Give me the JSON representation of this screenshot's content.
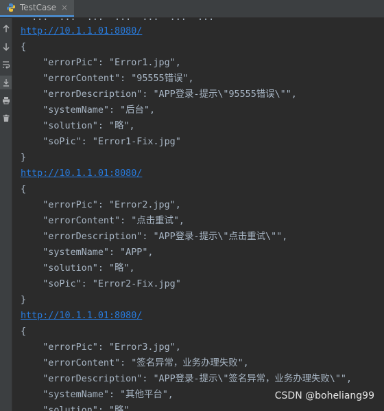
{
  "tab": {
    "title": "TestCase",
    "close_glyph": "×",
    "icon": "python-icon"
  },
  "toolbar": [
    {
      "icon": "up-arrow-icon"
    },
    {
      "icon": "down-arrow-icon"
    },
    {
      "icon": "soft-wrap-icon"
    },
    {
      "icon": "scroll-to-end-icon"
    },
    {
      "icon": "print-icon"
    },
    {
      "icon": "trash-icon"
    }
  ],
  "console": {
    "clipped_line": "  ...  ...  ...  ...  ...  ...  ...",
    "lines": [
      {
        "kind": "link",
        "text": "http://10.1.1.01:8080/"
      },
      {
        "kind": "text",
        "text": "{"
      },
      {
        "kind": "text",
        "text": "    \"errorPic\": \"Error1.jpg\","
      },
      {
        "kind": "text",
        "text": "    \"errorContent\": \"95555错误\","
      },
      {
        "kind": "text",
        "text": "    \"errorDescription\": \"APP登录-提示\\\"95555错误\\\"\","
      },
      {
        "kind": "text",
        "text": "    \"systemName\": \"后台\","
      },
      {
        "kind": "text",
        "text": "    \"solution\": \"略\","
      },
      {
        "kind": "text",
        "text": "    \"soPic\": \"Error1-Fix.jpg\""
      },
      {
        "kind": "text",
        "text": "}"
      },
      {
        "kind": "link",
        "text": "http://10.1.1.01:8080/"
      },
      {
        "kind": "text",
        "text": "{"
      },
      {
        "kind": "text",
        "text": "    \"errorPic\": \"Error2.jpg\","
      },
      {
        "kind": "text",
        "text": "    \"errorContent\": \"点击重试\","
      },
      {
        "kind": "text",
        "text": "    \"errorDescription\": \"APP登录-提示\\\"点击重试\\\"\","
      },
      {
        "kind": "text",
        "text": "    \"systemName\": \"APP\","
      },
      {
        "kind": "text",
        "text": "    \"solution\": \"略\","
      },
      {
        "kind": "text",
        "text": "    \"soPic\": \"Error2-Fix.jpg\""
      },
      {
        "kind": "text",
        "text": "}"
      },
      {
        "kind": "link",
        "text": "http://10.1.1.01:8080/"
      },
      {
        "kind": "text",
        "text": "{"
      },
      {
        "kind": "text",
        "text": "    \"errorPic\": \"Error3.jpg\","
      },
      {
        "kind": "text",
        "text": "    \"errorContent\": \"签名异常，业务办理失败\","
      },
      {
        "kind": "text",
        "text": "    \"errorDescription\": \"APP登录-提示\\\"签名异常，业务办理失败\\\"\","
      },
      {
        "kind": "text",
        "text": "    \"systemName\": \"其他平台\","
      },
      {
        "kind": "text",
        "text": "    \"solution\": \"略\""
      }
    ]
  },
  "watermark": "CSDN @boheliang99",
  "colors": {
    "link": "#287bde",
    "text": "#a9b7c6",
    "background": "#2b2b2b"
  }
}
